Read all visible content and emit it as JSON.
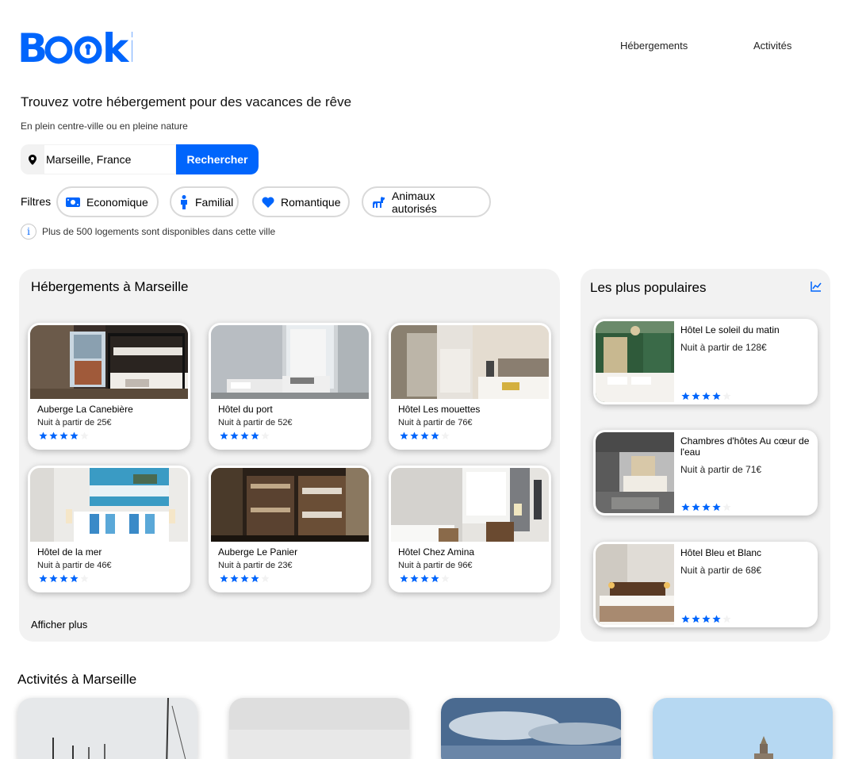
{
  "header": {
    "logo": "Booki",
    "nav": [
      "Hébergements",
      "Activités"
    ]
  },
  "search": {
    "headline": "Trouvez votre hébergement pour des vacances de rêve",
    "subline": "En plein centre-ville ou en pleine nature",
    "value": "Marseille, France",
    "button_label": "Rechercher"
  },
  "filters": {
    "label": "Filtres",
    "items": [
      {
        "label": "Economique",
        "icon": "money-icon"
      },
      {
        "label": "Familial",
        "icon": "person-icon"
      },
      {
        "label": "Romantique",
        "icon": "heart-icon"
      },
      {
        "label": "Animaux autorisés",
        "icon": "dog-icon"
      }
    ]
  },
  "info": {
    "text": "Plus de 500 logements sont disponibles dans cette ville"
  },
  "accommodations": {
    "title": "Hébergements à Marseille",
    "show_more": "Afficher plus",
    "items": [
      {
        "name": "Auberge La Canebière",
        "price": "Nuit à partir de 25€",
        "rating": 4
      },
      {
        "name": "Hôtel du port",
        "price": "Nuit à partir de 52€",
        "rating": 4
      },
      {
        "name": "Hôtel Les mouettes",
        "price": "Nuit à partir de 76€",
        "rating": 4
      },
      {
        "name": "Hôtel de la mer",
        "price": "Nuit à partir de 46€",
        "rating": 4
      },
      {
        "name": "Auberge Le Panier",
        "price": "Nuit à partir de 23€",
        "rating": 4
      },
      {
        "name": "Hôtel Chez Amina",
        "price": "Nuit à partir de 96€",
        "rating": 4
      }
    ]
  },
  "popular": {
    "title": "Les plus populaires",
    "items": [
      {
        "name": "Hôtel Le soleil du matin",
        "price": "Nuit à partir de 128€",
        "rating": 4
      },
      {
        "name": "Chambres d'hôtes Au cœur de l'eau",
        "price": "Nuit à partir de 71€",
        "rating": 4
      },
      {
        "name": "Hôtel Bleu et Blanc",
        "price": "Nuit à partir de 68€",
        "rating": 4
      }
    ]
  },
  "activities": {
    "title": "Activités à Marseille"
  },
  "colors": {
    "primary": "#0065FC",
    "panel": "#F2F2F2",
    "star_empty": "#F2F2F2"
  }
}
